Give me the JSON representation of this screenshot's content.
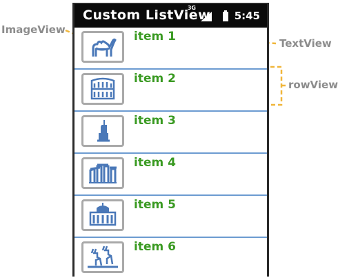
{
  "app": {
    "title": "Custom ListView",
    "network": "3G",
    "time": "5:45"
  },
  "items": [
    {
      "label": "item 1",
      "icon": "camel-icon"
    },
    {
      "label": "item 2",
      "icon": "colosseum-icon"
    },
    {
      "label": "item 3",
      "icon": "statue-of-liberty-icon"
    },
    {
      "label": "item 4",
      "icon": "stonehenge-icon"
    },
    {
      "label": "item 5",
      "icon": "palace-icon"
    },
    {
      "label": "item 6",
      "icon": "deer-icon"
    }
  ],
  "annotations": {
    "image_view": "ImageView",
    "text_view": "TextView",
    "row_view": "rowView"
  },
  "colors": {
    "text": "#3a9a22",
    "icon": "#4a78b8",
    "divider": "#6c9bd1",
    "callout_line": "#f0b63a",
    "callout_text": "#8c8c8c"
  }
}
